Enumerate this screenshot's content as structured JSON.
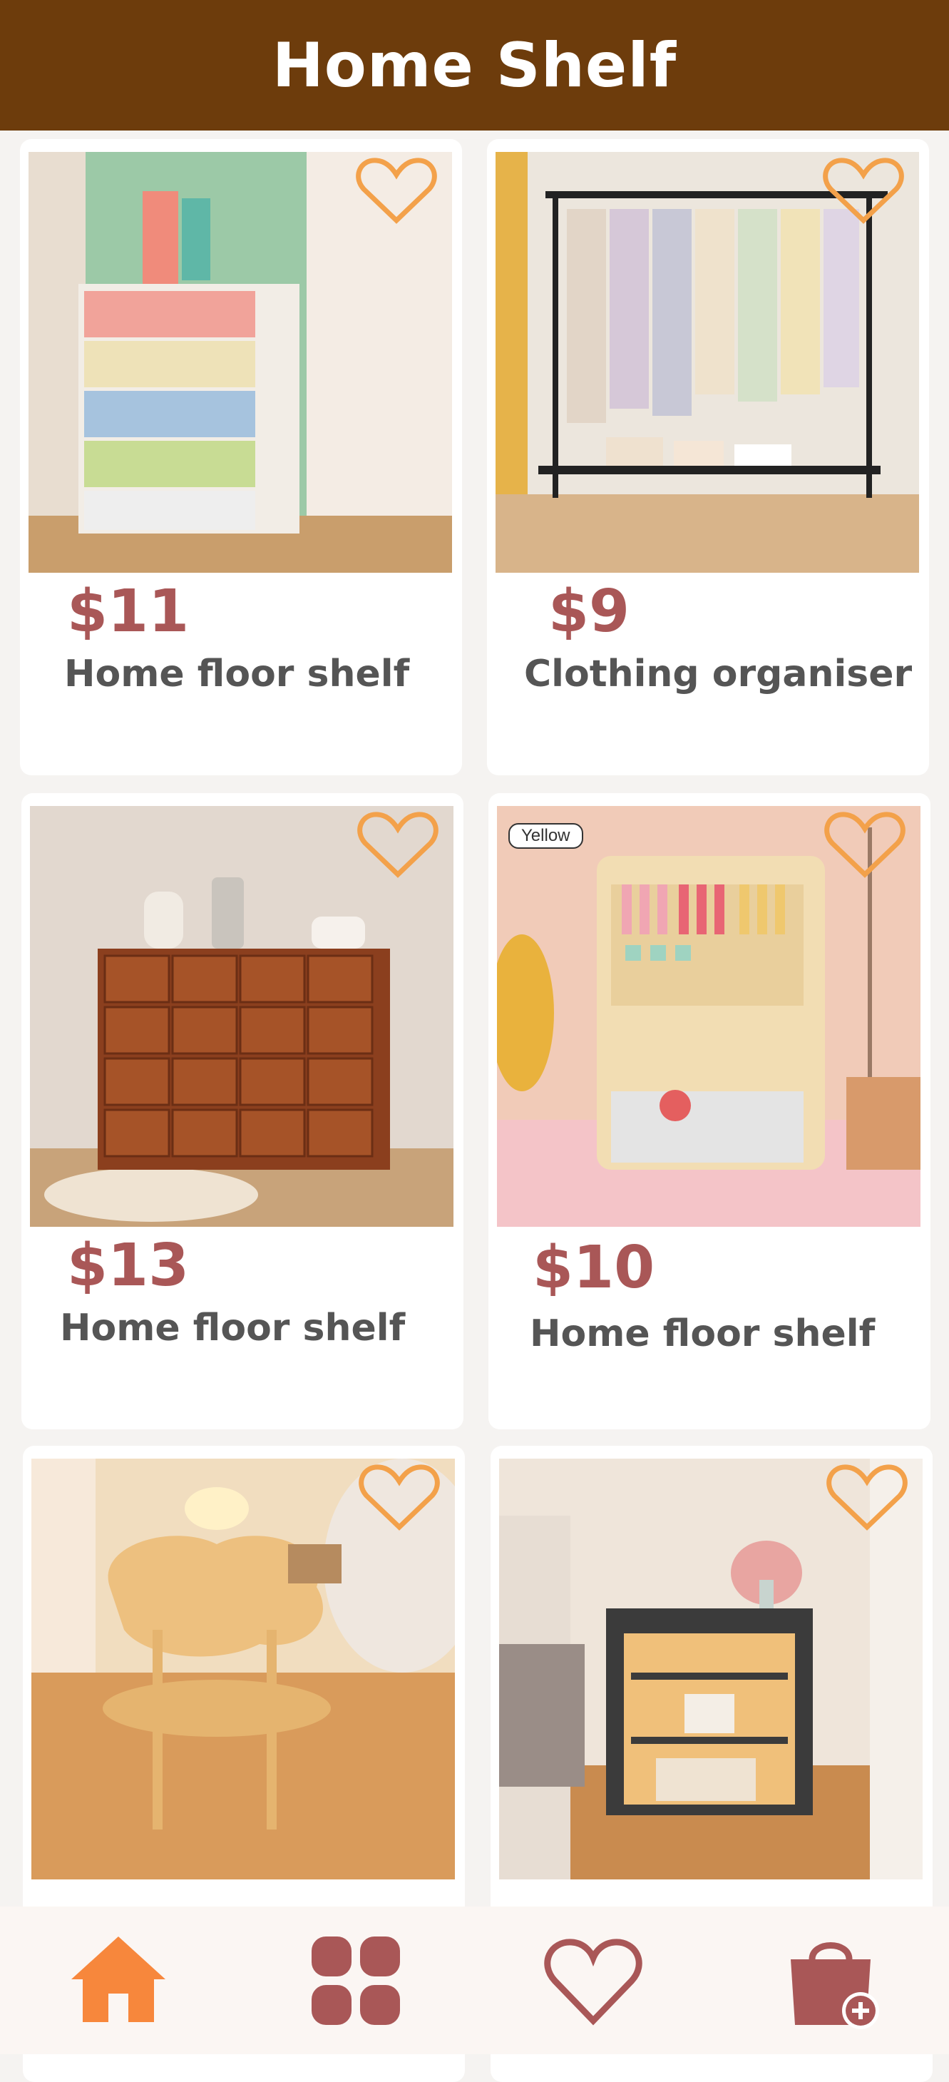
{
  "app": {
    "title": "Home Shelf"
  },
  "products": [
    {
      "price": "$11",
      "name": "Home floor shelf",
      "image_label": ""
    },
    {
      "price": "$9",
      "name": "Clothing organiser",
      "image_label": ""
    },
    {
      "price": "$13",
      "name": "Home floor shelf",
      "image_label": ""
    },
    {
      "price": "$10",
      "name": "Home floor shelf",
      "image_label": "Yellow"
    },
    {
      "price": "",
      "name": "",
      "image_label": ""
    },
    {
      "price": "",
      "name": "",
      "image_label": ""
    }
  ],
  "nav": {
    "items": [
      {
        "icon": "home-icon",
        "active": true
      },
      {
        "icon": "grid-icon",
        "active": false
      },
      {
        "icon": "heart-icon",
        "active": false
      },
      {
        "icon": "shopping-bag-add-icon",
        "active": false
      }
    ]
  },
  "colors": {
    "header": "#6d3c0c",
    "price": "#a95757",
    "accent": "#f7873c",
    "fav": "#f3a14a"
  }
}
